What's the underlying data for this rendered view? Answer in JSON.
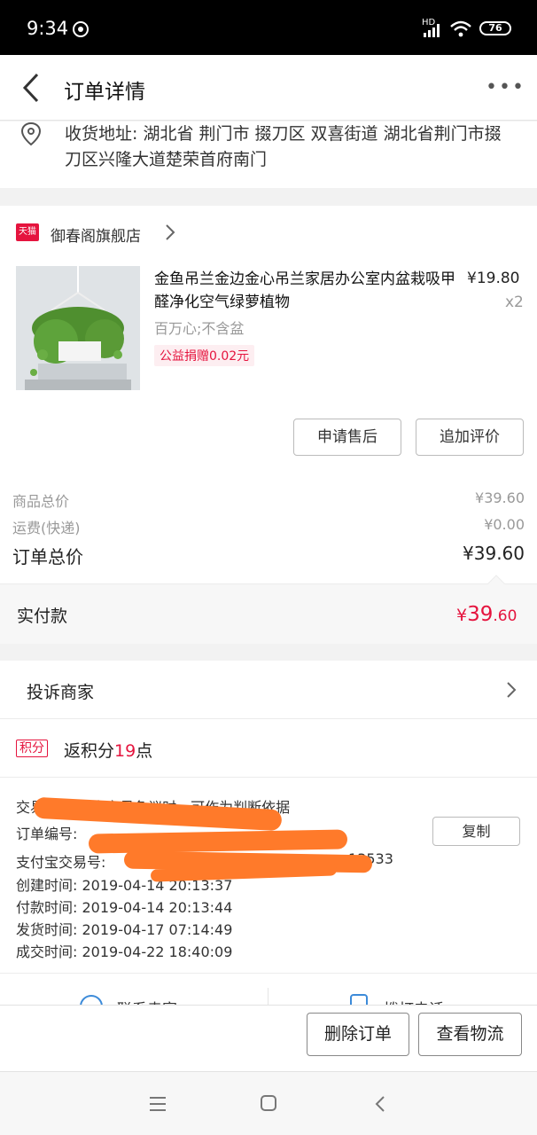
{
  "status_bar": {
    "time": "9:34",
    "battery": "76",
    "network": "HD"
  },
  "header": {
    "title": "订单详情",
    "more": "•••"
  },
  "address": {
    "text": "收货地址: 湖北省 荆门市 掇刀区 双喜街道 湖北省荆门市掇刀区兴隆大道楚荣首府南门"
  },
  "store": {
    "badge": "天猫",
    "name": "御春阁旗舰店"
  },
  "product": {
    "title": "金鱼吊兰金边金心吊兰家居办公室内盆栽吸甲醛净化空气绿萝植物",
    "price": "¥19.80",
    "qty": "x2",
    "spec": "百万心;不含盆",
    "tag": "公益捐赠0.02元"
  },
  "actions": {
    "after_sale": "申请售后",
    "add_review": "追加评价"
  },
  "summary": {
    "goods_label": "商品总价",
    "goods_value": "¥39.60",
    "shipping_label": "运费(快递)",
    "shipping_value": "¥0.00",
    "total_label": "订单总价",
    "total_value": "¥39.60",
    "paid_label": "实付款",
    "paid_currency": "¥",
    "paid_int": "39",
    "paid_dec": ".60"
  },
  "complain": {
    "label": "投诉商家"
  },
  "points": {
    "badge": "积分",
    "prefix": "返积分",
    "value": "19",
    "suffix": "点"
  },
  "order_info": {
    "snapshot": "交易快照 发生交易争议时，可作为判断依据",
    "order_no_label": "订单编号:",
    "alipay_label": "支付宝交易号:",
    "alipay_tail": "13533",
    "created": "创建时间:  2019-04-14 20:13:37",
    "paid": "付款时间:  2019-04-14 20:13:44",
    "shipped": "发货时间:  2019-04-17 07:14:49",
    "closed": "成交时间:  2019-04-22 18:40:09",
    "copy": "复制"
  },
  "contact": {
    "seller": "联系卖家",
    "phone": "拨打电话"
  },
  "bottom": {
    "delete": "删除订单",
    "logistics": "查看物流"
  },
  "colors": {
    "accent": "#e5143e",
    "redact": "#ff7a2a"
  }
}
